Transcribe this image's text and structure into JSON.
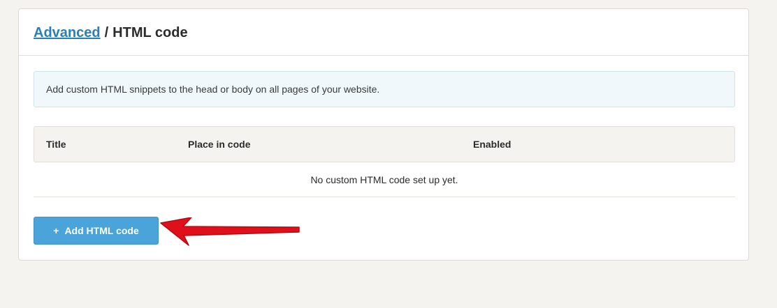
{
  "breadcrumb": {
    "parent": "Advanced",
    "separator": "/",
    "current": "HTML code"
  },
  "info": {
    "text": "Add custom HTML snippets to the head or body on all pages of your website."
  },
  "table": {
    "columns": [
      "Title",
      "Place in code",
      "Enabled"
    ],
    "empty_message": "No custom HTML code set up yet."
  },
  "actions": {
    "add_icon": "plus-icon",
    "add_symbol": "+",
    "add_label": "Add HTML code"
  },
  "annotation": {
    "arrow_color": "#e0101b",
    "arrow_icon": "red-arrow-icon"
  },
  "colors": {
    "background": "#f5f3ef",
    "link": "#2a7fb5",
    "button": "#4aa3d9",
    "info_background": "#f0f8fb"
  }
}
